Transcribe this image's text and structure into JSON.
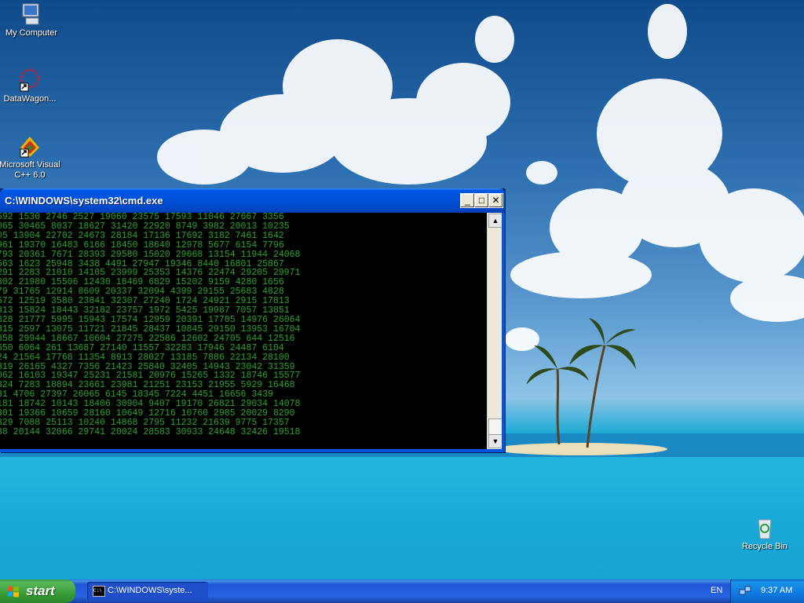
{
  "desktop": {
    "icons": [
      {
        "label": "My Computer"
      },
      {
        "label": "DataWagon..."
      },
      {
        "label": "Microsoft Visual C++ 6.0"
      },
      {
        "label": "Recycle Bin"
      }
    ]
  },
  "window": {
    "title": "C:\\WINDOWS\\system32\\cmd.exe",
    "minimize": "_",
    "maximize": "□",
    "close": "✕",
    "console_lines": [
      "592 1530 2746 2527 19060 23575 17593 11046 27667 3356",
      "065 30465 8037 18627 31420 22920 8749 3982 20013 10235",
      "05 13904 22702 24673 28184 17136 17692 3182 7461 1642",
      "961 19370 16483 6166 18450 18640 12978 5677 6154 7796",
      "793 20361 7671 28393 29580 15020 29668 13154 11944 24068",
      "563 1623 25948 3438 4491 27947 19346 8440 16801 25867",
      "291 2283 21010 14105 23999 25353 14376 22474 29205 29971",
      "802 21980 15506 12430 18469 6829 15202 9159 4280 1656",
      "79 31765 12914 8609 20337 32094 4399 29155 25683 4828",
      "572 12519 3580 23841 32307 27240 1724 24921 2915 17813",
      "813 15824 18443 32182 23757 1972 5425 19987 7057 13851",
      "828 21777 5995 15943 17574 12959 20391 17705 14976 26064",
      "815 2597 13075 11721 21845 28437 10845 29150 13953 16704",
      "858 29944 18667 10604 27275 22586 12602 24705 644 12516",
      "650 6064 261 13687 27140 11557 32283 17946 24487 6104",
      "24 21564 17768 11354 8913 28027 13185 7886 22134 28100",
      "319 26165 4327 7356 21423 25840 32405 14943 23042 31359",
      "062 16103 19347 25231 21581 20976 15265 1332 18746 15577",
      "824 7283 18894 23661 23981 21251 23153 21955 5929 16468",
      "81 4706 27397 26065 6145 18345 7224 4451 16656 3439",
      "181 18742 10143 18406 30904 9407 19170 26821 29034 14078",
      "801 19366 10659 28160 10649 12716 10760 2985 20029 8290",
      "829 7088 25113 10240 14868 2795 11232 21639 9775 17357",
      "38 20144 32066 29741 20024 28583 30933 24648 32426 19518"
    ]
  },
  "taskbar": {
    "start_label": "start",
    "task_label": "C:\\WINDOWS\\syste...",
    "task_icon_text": "C:\\",
    "language": "EN",
    "clock": "9:37 AM"
  },
  "colors": {
    "console_text": "#2aa42a",
    "titlebar": "#0050d8",
    "taskbar": "#2663e0"
  }
}
